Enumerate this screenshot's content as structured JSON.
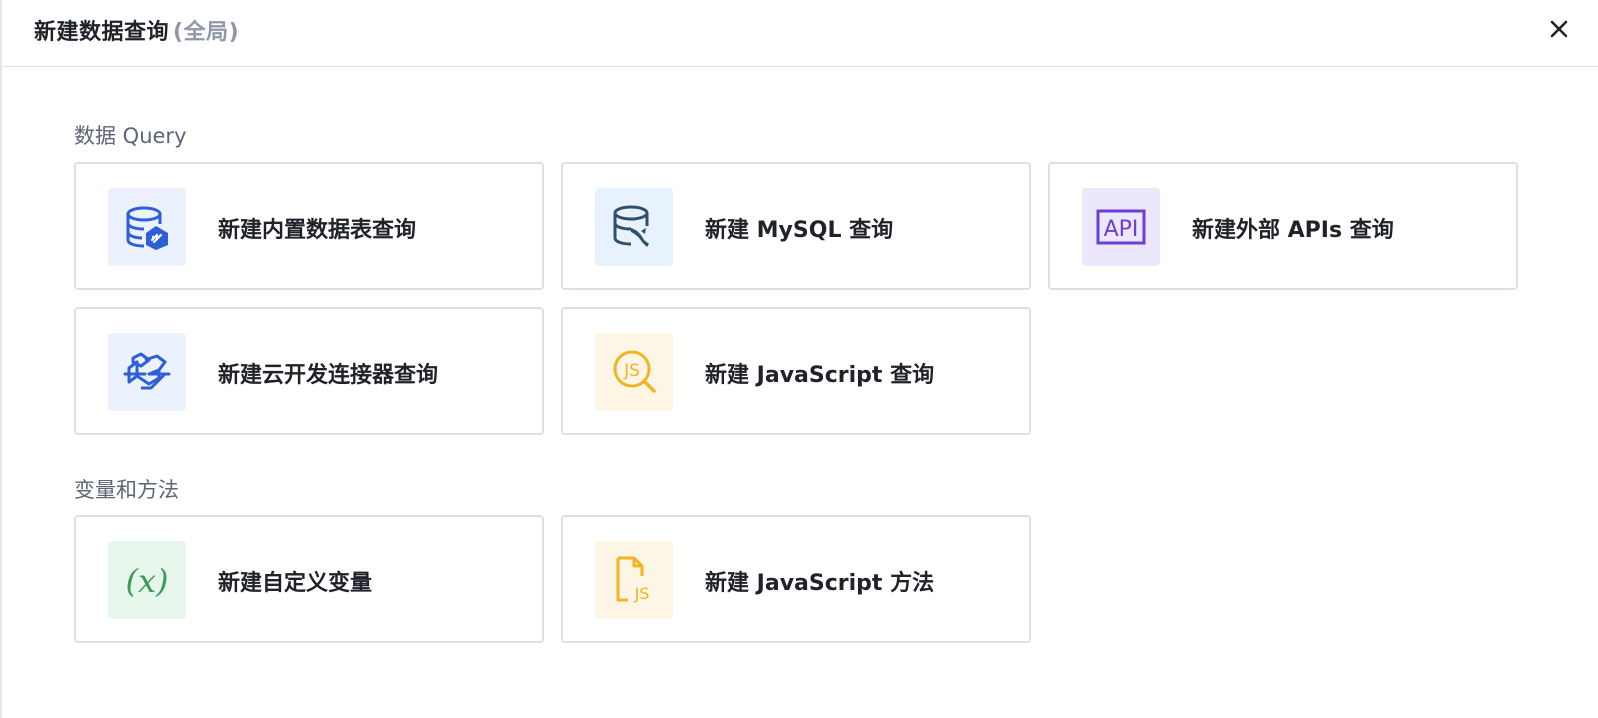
{
  "header": {
    "title": "新建数据查询",
    "scope": "(全局)"
  },
  "sections": [
    {
      "label": "数据 Query",
      "cards": [
        {
          "label": "新建内置数据表查询",
          "icon": "database-sync-icon"
        },
        {
          "label": "新建 MySQL 查询",
          "icon": "mysql-icon"
        },
        {
          "label": "新建外部 APIs 查询",
          "icon": "api-icon"
        },
        {
          "label": "新建云开发连接器查询",
          "icon": "connector-icon"
        },
        {
          "label": "新建 JavaScript 查询",
          "icon": "js-search-icon"
        }
      ]
    },
    {
      "label": "变量和方法",
      "cards": [
        {
          "label": "新建自定义变量",
          "icon": "variable-icon"
        },
        {
          "label": "新建 JavaScript 方法",
          "icon": "js-file-icon"
        }
      ]
    }
  ],
  "icon_text": {
    "api": "API",
    "js": "JS",
    "variable": "(x)"
  },
  "colors": {
    "blue": "#2e5fd9",
    "slate": "#2f4f6b",
    "purple": "#6b3fd4",
    "yellow": "#f0b424",
    "green": "#3e9a5c"
  }
}
